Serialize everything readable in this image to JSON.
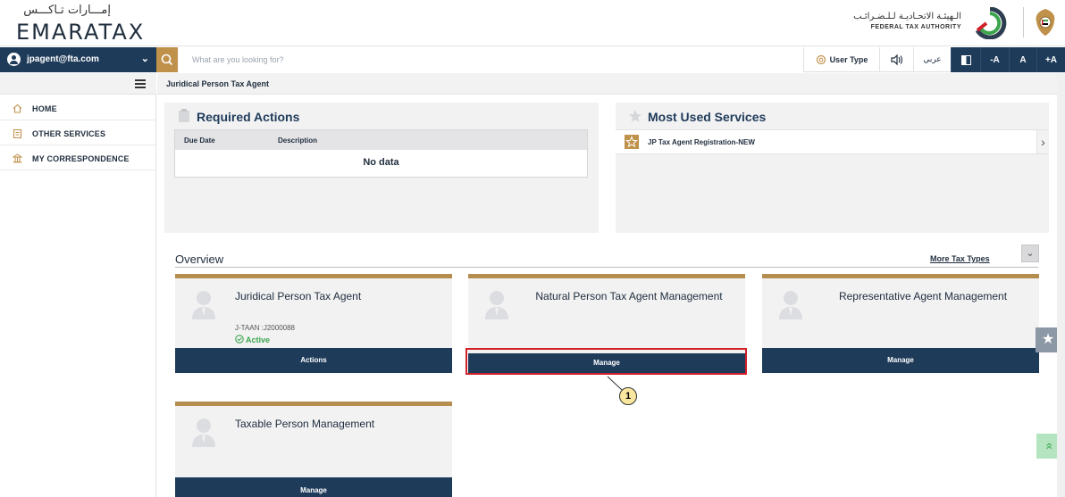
{
  "header": {
    "logo_ar": "إمـــارات تـاكـــس",
    "logo_en": "EMARATAX",
    "fta_ar": "الـهيئـة الاتحـاديـة لـلـضـرائـب",
    "fta_en": "FEDERAL TAX AUTHORITY"
  },
  "topbar": {
    "user_email": "jpagent@fta.com",
    "search_placeholder": "What are you looking for?",
    "user_type": "User Type",
    "language": "عربي",
    "font_minus": "-A",
    "font_normal": "A",
    "font_plus": "+A"
  },
  "sidebar": {
    "items": [
      {
        "label": "HOME",
        "icon": "home-icon"
      },
      {
        "label": "OTHER SERVICES",
        "icon": "clipboard-icon"
      },
      {
        "label": "MY CORRESPONDENCE",
        "icon": "building-icon"
      }
    ]
  },
  "breadcrumb": "Juridical Person Tax Agent",
  "required_actions": {
    "title": "Required Actions",
    "col_due": "Due Date",
    "col_desc": "Description",
    "empty": "No data"
  },
  "most_used": {
    "title": "Most Used Services",
    "item": "JP Tax Agent Registration-NEW"
  },
  "overview": {
    "title": "Overview",
    "more": "More Tax Types",
    "cards": [
      {
        "title": "Juridical Person Tax Agent",
        "sub": "J-TAAN :J2000088",
        "status": "Active",
        "button": "Actions"
      },
      {
        "title": "Natural Person Tax Agent Management",
        "button": "Manage"
      },
      {
        "title": "Representative Agent Management",
        "button": "Manage"
      },
      {
        "title": "Taxable Person Management",
        "button": "Manage"
      }
    ]
  },
  "callout": "1",
  "colors": {
    "navy": "#1f3b5a",
    "gold": "#b58e4f",
    "active_green": "#3aa54b",
    "highlight_red": "#d0202a"
  }
}
